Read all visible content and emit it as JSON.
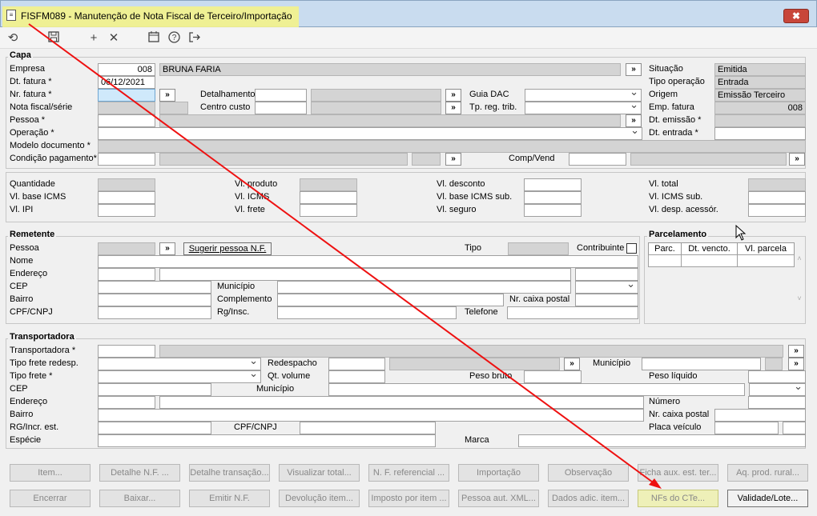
{
  "window": {
    "title": "FISFM089 - Manutenção de Nota Fiscal de Terceiro/Importação",
    "close_glyph": "✖"
  },
  "toolbar": {
    "icons": [
      "undo-icon",
      "save-icon",
      "add-icon",
      "delete-icon",
      "calendar-icon",
      "help-icon",
      "exit-icon"
    ]
  },
  "capa": {
    "legend": "Capa",
    "empresa_label": "Empresa",
    "empresa_code": "008",
    "empresa_name": "BRUNA FARIA",
    "dt_fatura_label": "Dt. fatura *",
    "dt_fatura": "06/12/2021",
    "nr_fatura_label": "Nr. fatura *",
    "nota_label": "Nota fiscal/série",
    "pessoa_label": "Pessoa *",
    "operacao_label": "Operação *",
    "modelo_label": "Modelo documento *",
    "condicao_label": "Condição pagamento*",
    "detalhamento_label": "Detalhamento",
    "centro_label": "Centro custo",
    "guia_label": "Guia DAC",
    "tpreg_label": "Tp. reg. trib.",
    "comp_label": "Comp/Vend",
    "situacao_label": "Situação",
    "situacao": "Emitida",
    "tipo_op_label": "Tipo operação",
    "tipo_op": "Entrada",
    "origem_label": "Origem",
    "origem": "Emissão Terceiro",
    "emp_fatura_label": "Emp. fatura",
    "emp_fatura": "008",
    "dt_emissao_label": "Dt. emissão *",
    "dt_entrada_label": "Dt. entrada *"
  },
  "totais": {
    "quantidade": "Quantidade",
    "base_icms": "Vl. base ICMS",
    "ipi": "Vl. IPI",
    "produto": "Vl. produto",
    "icms": "Vl. ICMS",
    "frete": "Vl. frete",
    "desconto": "Vl. desconto",
    "base_icms_sub": "Vl. base ICMS sub.",
    "seguro": "Vl. seguro",
    "total": "Vl. total",
    "icms_sub": "Vl. ICMS sub.",
    "desp": "Vl. desp. acessór."
  },
  "remetente": {
    "legend": "Remetente",
    "pessoa": "Pessoa",
    "sugerir": "Sugerir pessoa N.F.",
    "tipo": "Tipo",
    "contribuinte": "Contribuinte",
    "nome": "Nome",
    "endereco": "Endereço",
    "cep": "CEP",
    "municipio": "Município",
    "bairro": "Bairro",
    "complemento": "Complemento",
    "caixa_postal": "Nr. caixa postal",
    "cpf": "CPF/CNPJ",
    "rg": "Rg/Insc.",
    "telefone": "Telefone"
  },
  "parcelamento": {
    "legend": "Parcelamento",
    "cols": [
      "Parc.",
      "Dt. vencto.",
      "Vl. parcela"
    ]
  },
  "transportadora": {
    "legend": "Transportadora",
    "transportadora": "Transportadora *",
    "tipo_frete_redesp": "Tipo frete redesp.",
    "redespacho": "Redespacho",
    "municipio": "Município",
    "tipo_frete": "Tipo frete *",
    "qt_volume": "Qt. volume",
    "peso_bruto": "Peso bruto",
    "peso_liquido": "Peso líquido",
    "cep": "CEP",
    "municipio2": "Município",
    "endereco": "Endereço",
    "numero": "Número",
    "bairro": "Bairro",
    "caixa_postal": "Nr. caixa postal",
    "rg": "RG/Incr. est.",
    "cpf": "CPF/CNPJ",
    "placa": "Placa veículo",
    "especie": "Espécie",
    "marca": "Marca"
  },
  "buttons": {
    "row1": [
      "Item...",
      "Detalhe N.F. ...",
      "Detalhe transação...",
      "Visualizar total...",
      "N. F. referencial ...",
      "Importação",
      "Observação",
      "Ficha aux. est. ter...",
      "Aq. prod. rural..."
    ],
    "row2": [
      "Encerrar",
      "Baixar...",
      "Emitir N.F.",
      "Devolução item...",
      "Imposto por item ...",
      "Pessoa aut. XML...",
      "Dados adic. item...",
      "NFs do CTe...",
      "Validade/Lote..."
    ]
  }
}
